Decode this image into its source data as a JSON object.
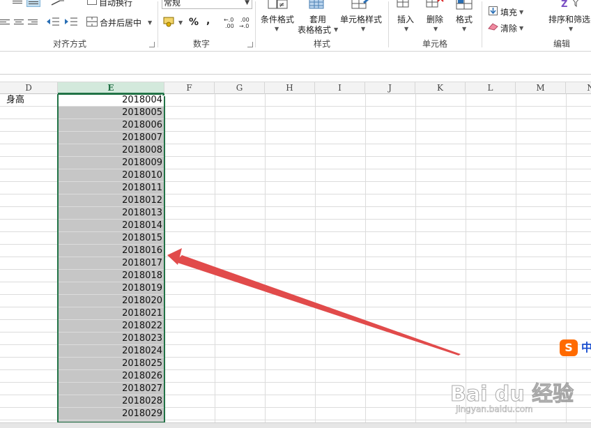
{
  "ribbon": {
    "alignment": {
      "wrap_text": "自动换行",
      "merge_center": "合并后居中",
      "group_label": "对齐方式"
    },
    "number": {
      "format_value": "常规",
      "percent": "%",
      "comma": ",",
      "group_label": "数字"
    },
    "styles": {
      "conditional_format": "条件格式",
      "table_format_line1": "套用",
      "table_format_line2": "表格格式",
      "cell_styles": "单元格样式",
      "group_label": "样式"
    },
    "cells": {
      "insert": "插入",
      "delete": "删除",
      "format": "格式",
      "group_label": "单元格"
    },
    "editing": {
      "fill": "填充",
      "clear": "清除",
      "sort_filter": "排序和筛选",
      "group_label": "编辑"
    }
  },
  "sheet": {
    "columns": [
      "D",
      "E",
      "F",
      "G",
      "H",
      "I",
      "J",
      "K",
      "L",
      "M",
      "N"
    ],
    "selected_column": "E",
    "d_header_cell": "身高",
    "e_values": [
      "2018004",
      "2018005",
      "2018006",
      "2018007",
      "2018008",
      "2018009",
      "2018010",
      "2018011",
      "2018012",
      "2018013",
      "2018014",
      "2018015",
      "2018016",
      "2018017",
      "2018018",
      "2018019",
      "2018020",
      "2018021",
      "2018022",
      "2018023",
      "2018024",
      "2018025",
      "2018026",
      "2018027",
      "2018028",
      "2018029"
    ]
  },
  "overlay": {
    "ime_logo": "S",
    "ime_mode": "中",
    "watermark_brand": "Bai du 经验",
    "watermark_url": "jingyan.baidu.com"
  },
  "colors": {
    "selection_green": "#217346",
    "selected_fill": "#c6c6c6",
    "arrow_red": "#e14b4b",
    "ime_orange": "#ff6a00"
  }
}
